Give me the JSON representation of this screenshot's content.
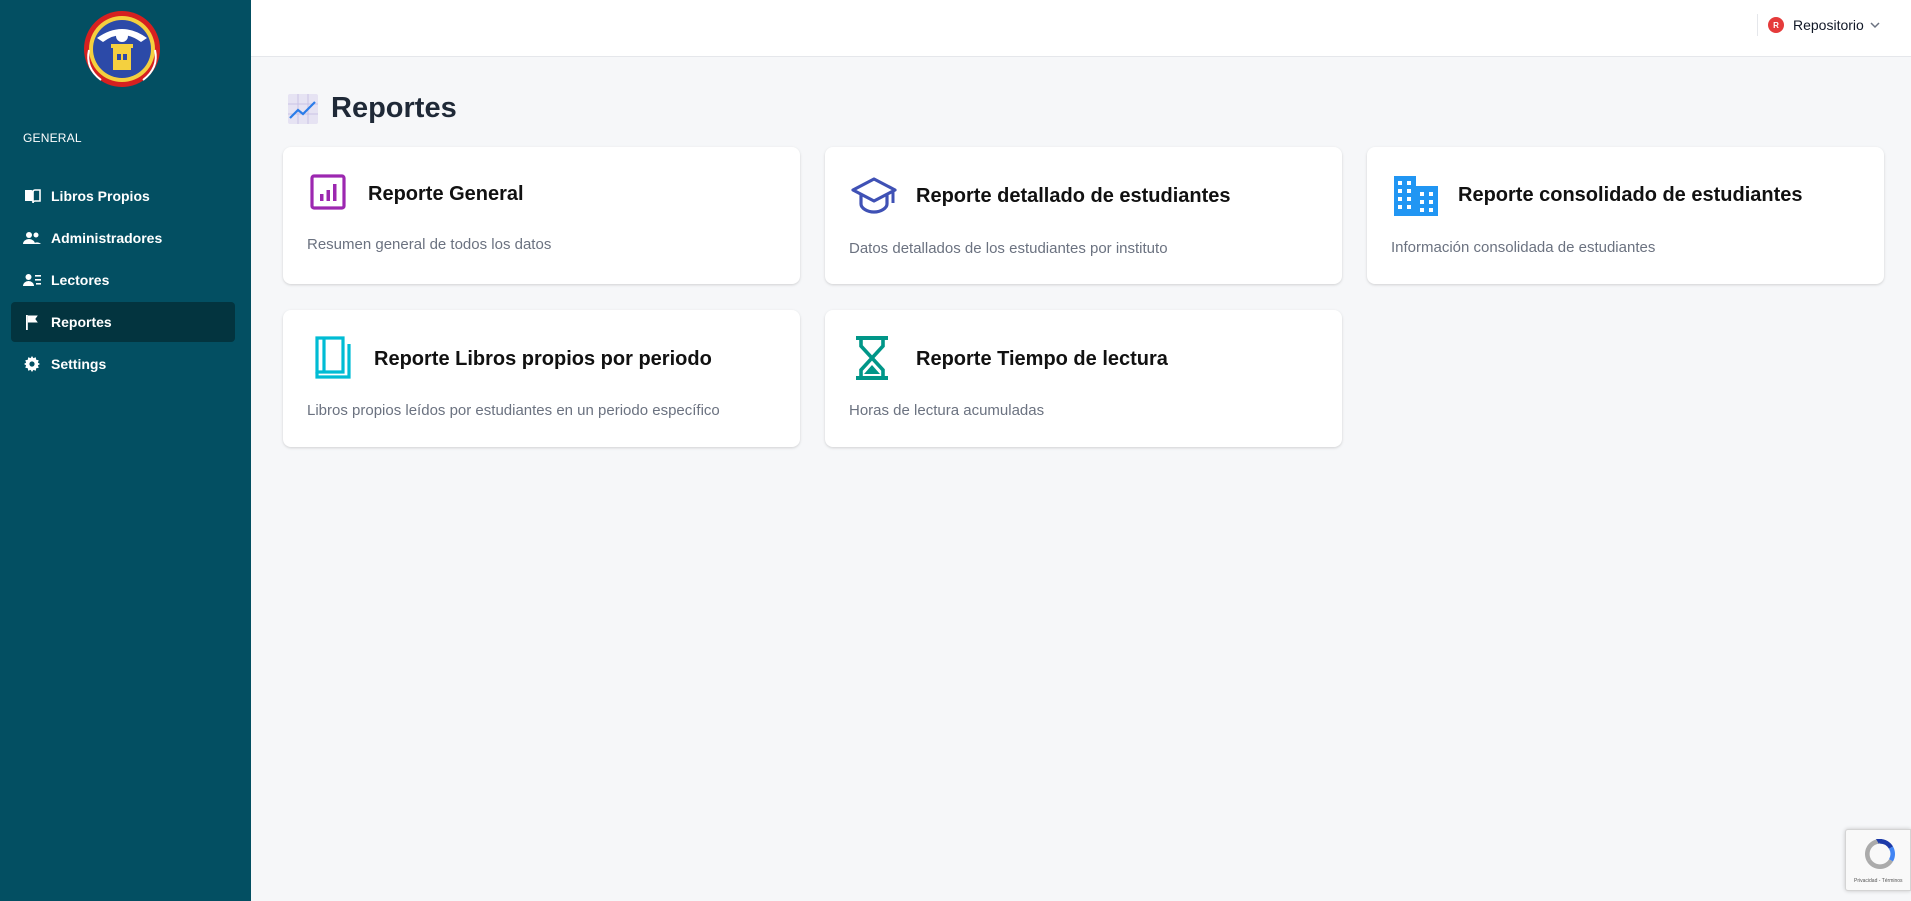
{
  "sidebar": {
    "section_label": "GENERAL",
    "items": [
      {
        "label": "Libros Propios",
        "icon": "book-icon"
      },
      {
        "label": "Administradores",
        "icon": "users-icon"
      },
      {
        "label": "Lectores",
        "icon": "user-list-icon"
      },
      {
        "label": "Reportes",
        "icon": "flag-icon",
        "active": true
      },
      {
        "label": "Settings",
        "icon": "gear-icon"
      }
    ]
  },
  "topbar": {
    "user_initial": "R",
    "user_name": "Repositorio"
  },
  "page": {
    "title": "Reportes",
    "title_icon": "chart-line-icon"
  },
  "cards": [
    {
      "title": "Reporte General",
      "description": "Resumen general de todos los datos",
      "icon": "bar-chart-icon",
      "color": "#9c27b0"
    },
    {
      "title": "Reporte detallado de estudiantes",
      "description": "Datos detallados de los estudiantes por instituto",
      "icon": "graduation-cap-icon",
      "color": "#3f51b5"
    },
    {
      "title": "Reporte consolidado de estudiantes",
      "description": "Información consolidada de estudiantes",
      "icon": "building-icon",
      "color": "#2196f3"
    },
    {
      "title": "Reporte Libros propios por periodo",
      "description": "Libros propios leídos por estudiantes en un periodo específico",
      "icon": "book-outline-icon",
      "color": "#00bcd4"
    },
    {
      "title": "Reporte Tiempo de lectura",
      "description": "Horas de lectura acumuladas",
      "icon": "hourglass-icon",
      "color": "#009688"
    }
  ],
  "recaptcha": {
    "footer_text": "Privacidad - Términos"
  }
}
